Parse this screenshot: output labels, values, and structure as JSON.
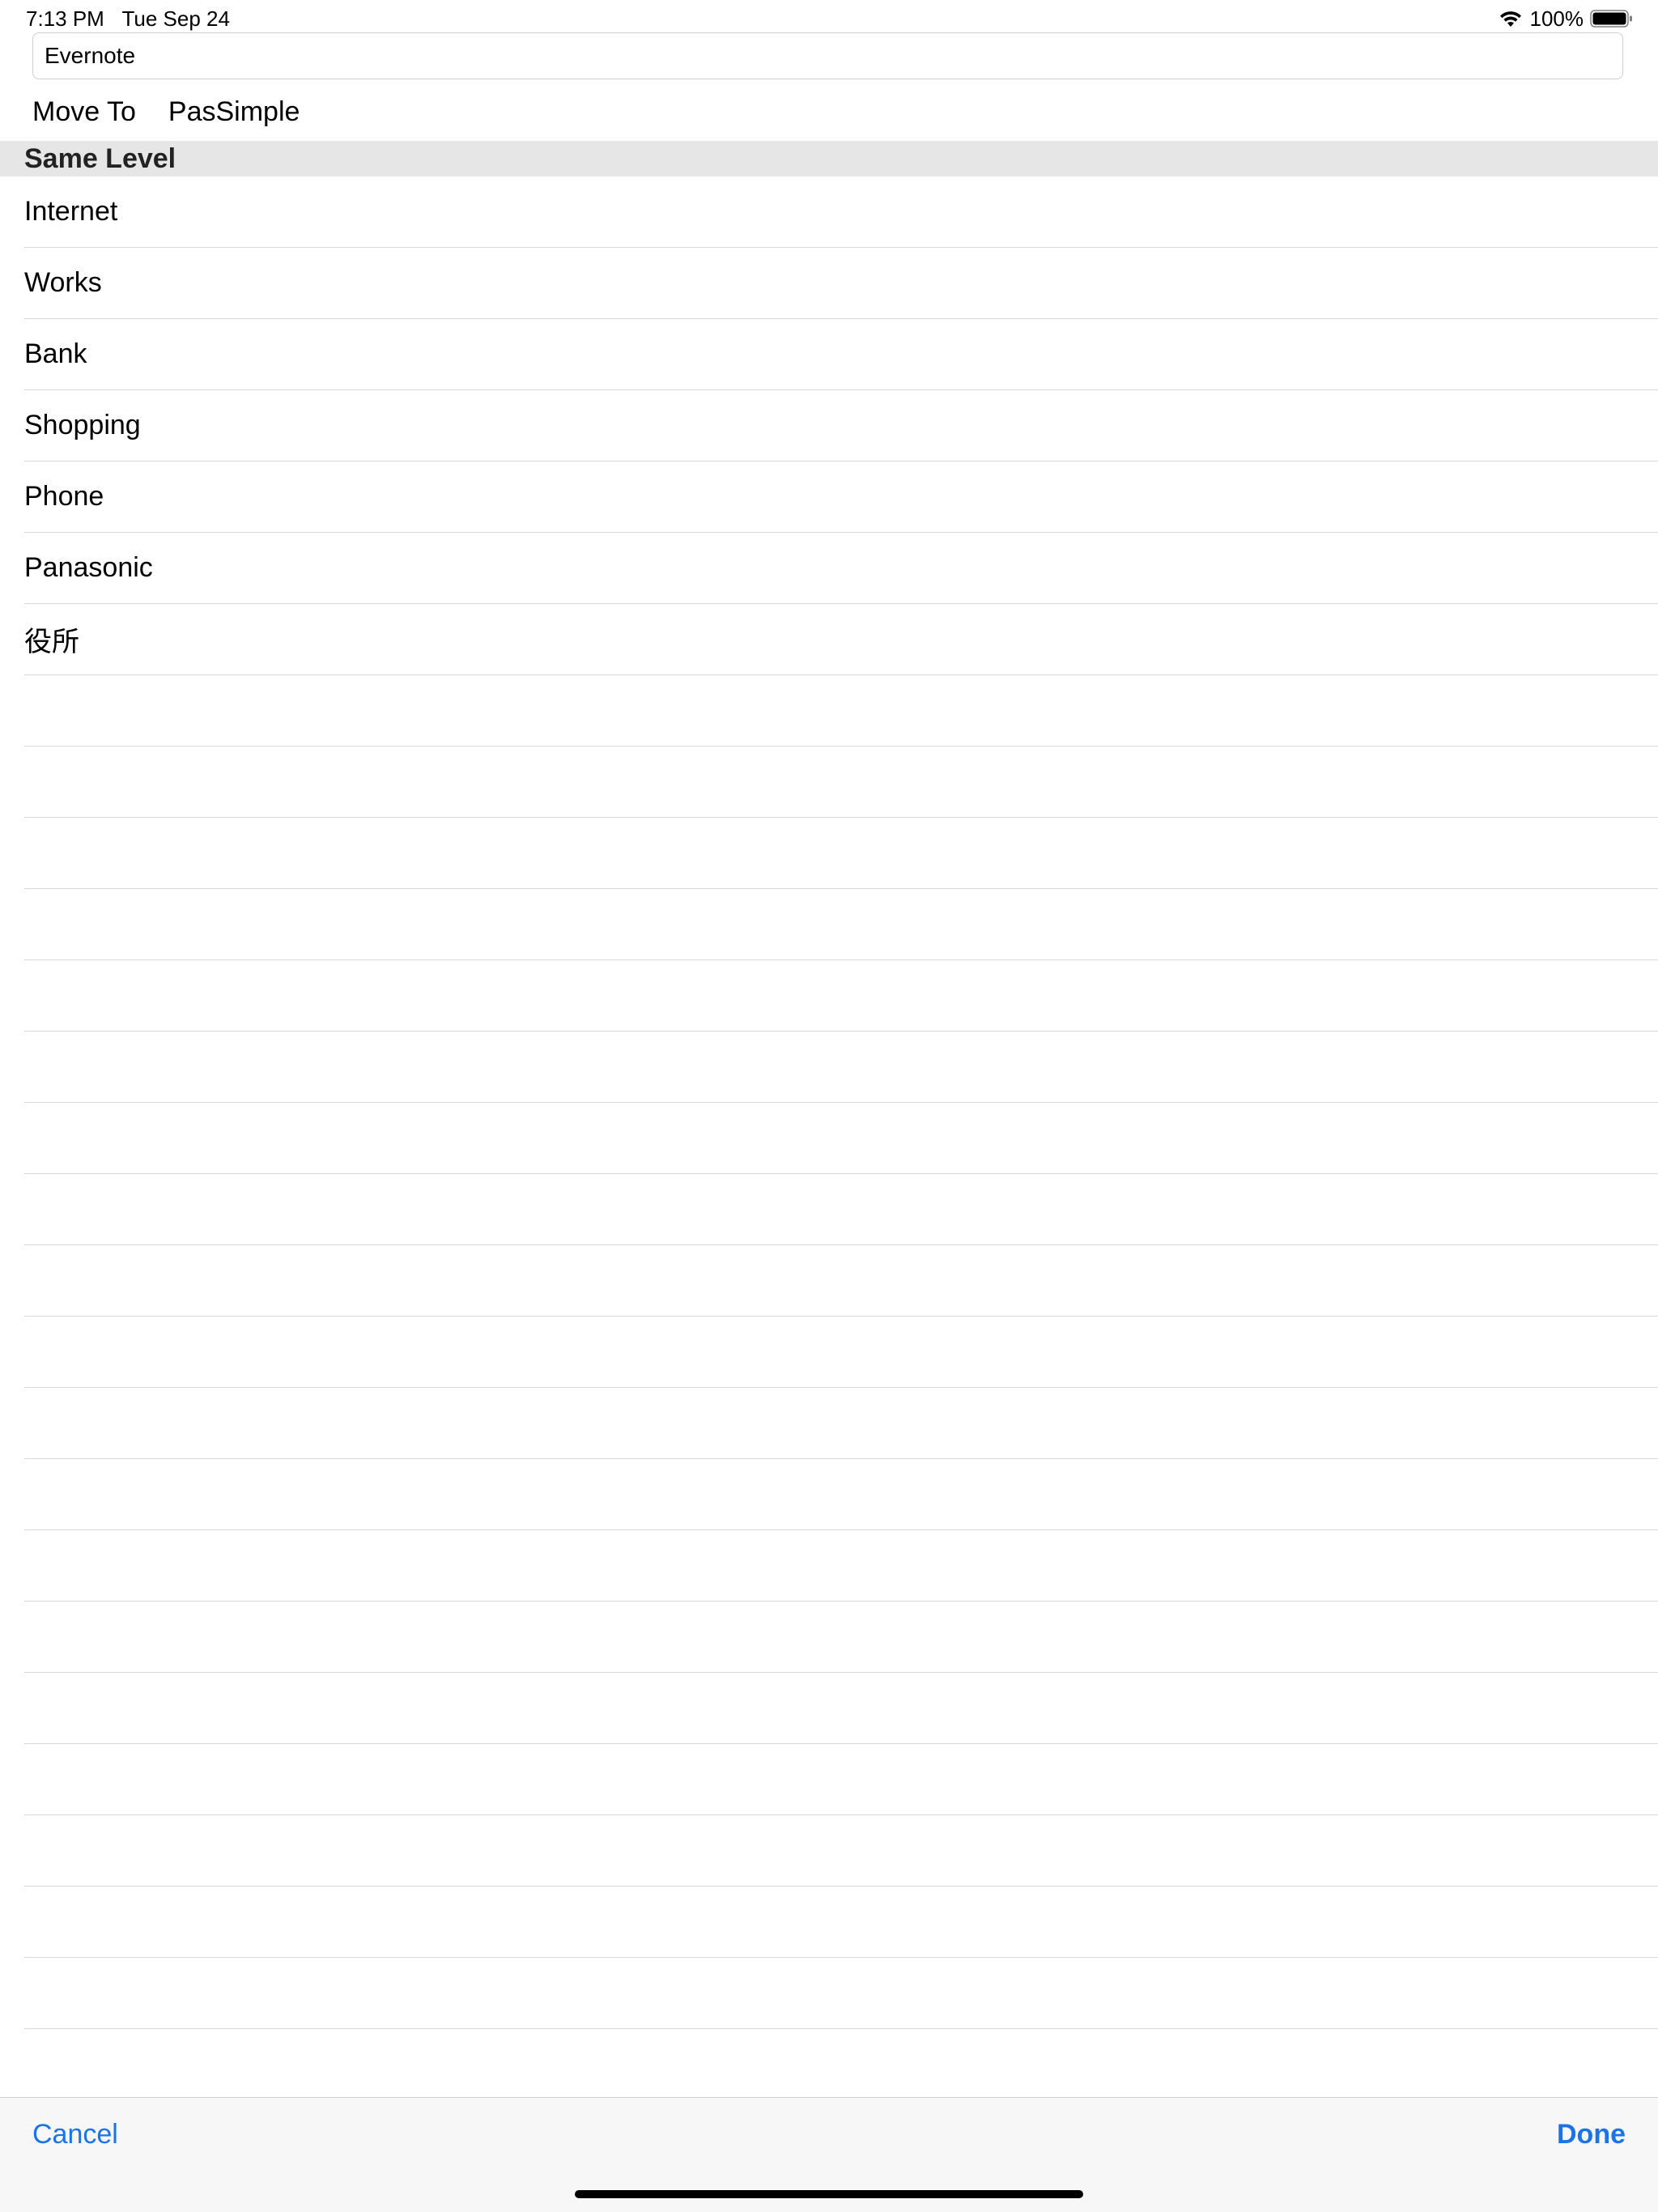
{
  "status_bar": {
    "time": "7:13 PM",
    "date": "Tue Sep 24",
    "battery_percent": "100%",
    "wifi_icon": "wifi-icon",
    "battery_icon": "battery-full-icon"
  },
  "search": {
    "value": "Evernote",
    "placeholder": ""
  },
  "move_to": {
    "label": "Move To",
    "path": "PasSimple"
  },
  "section": {
    "title": "Same Level"
  },
  "rows": [
    {
      "label": "Internet"
    },
    {
      "label": "Works"
    },
    {
      "label": "Bank"
    },
    {
      "label": "Shopping"
    },
    {
      "label": "Phone"
    },
    {
      "label": "Panasonic"
    },
    {
      "label": "役所"
    }
  ],
  "toolbar": {
    "cancel_label": "Cancel",
    "done_label": "Done"
  },
  "colors": {
    "accent": "#1a73e8",
    "section_bg": "#e6e6e6",
    "separator": "#d8d8d8"
  }
}
